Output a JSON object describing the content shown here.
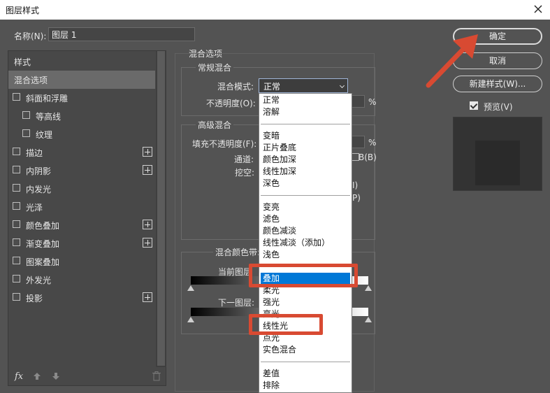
{
  "window": {
    "title": "图层样式"
  },
  "name_field": {
    "label": "名称(N):",
    "value": "图层 1"
  },
  "styles_panel": {
    "header": "样式",
    "items": [
      {
        "label": "混合选项",
        "checkbox": false,
        "plus": false,
        "selected": true,
        "indent": false
      },
      {
        "label": "斜面和浮雕",
        "checkbox": true,
        "plus": false,
        "indent": false
      },
      {
        "label": "等高线",
        "checkbox": true,
        "plus": false,
        "indent": true
      },
      {
        "label": "纹理",
        "checkbox": true,
        "plus": false,
        "indent": true
      },
      {
        "label": "描边",
        "checkbox": true,
        "plus": true,
        "indent": false
      },
      {
        "label": "内阴影",
        "checkbox": true,
        "plus": true,
        "indent": false
      },
      {
        "label": "内发光",
        "checkbox": true,
        "plus": false,
        "indent": false
      },
      {
        "label": "光泽",
        "checkbox": true,
        "plus": false,
        "indent": false
      },
      {
        "label": "颜色叠加",
        "checkbox": true,
        "plus": true,
        "indent": false
      },
      {
        "label": "渐变叠加",
        "checkbox": true,
        "plus": true,
        "indent": false
      },
      {
        "label": "图案叠加",
        "checkbox": true,
        "plus": false,
        "indent": false
      },
      {
        "label": "外发光",
        "checkbox": true,
        "plus": false,
        "indent": false
      },
      {
        "label": "投影",
        "checkbox": true,
        "plus": true,
        "indent": false
      }
    ],
    "fx_label": "fx"
  },
  "blending": {
    "section_title": "混合选项",
    "general_title": "常规混合",
    "mode_label": "混合模式:",
    "mode_value": "正常",
    "opacity_label": "不透明度(O):",
    "percent": "%",
    "advanced_title": "高级混合",
    "fill_opacity_label": "填充不透明度(F):",
    "channels_label": "通道:",
    "channel_b": "B(B)",
    "knockout_label": "挖空:",
    "partial_1": "I)",
    "partial_2": "P)",
    "blend_if_label": "混合颜色带:",
    "this_layer_label": "当前图层",
    "underlying_layer_label": "下一图层:"
  },
  "dropdown": {
    "groups": [
      [
        "正常",
        "溶解"
      ],
      [
        "变暗",
        "正片叠底",
        "颜色加深",
        "线性加深",
        "深色"
      ],
      [
        "变亮",
        "滤色",
        "颜色减淡",
        "线性减淡（添加）",
        "浅色"
      ],
      [
        "叠加",
        "柔光",
        "强光",
        "亮光",
        "线性光",
        "点光",
        "实色混合"
      ],
      [
        "差值",
        "排除"
      ]
    ],
    "highlighted": "叠加"
  },
  "buttons": {
    "ok": "确定",
    "cancel": "取消",
    "new_style": "新建样式(W)...",
    "preview_label": "预览(V)"
  },
  "colors": {
    "annotation_red": "#d84a32",
    "highlight_blue": "#0078d7"
  }
}
